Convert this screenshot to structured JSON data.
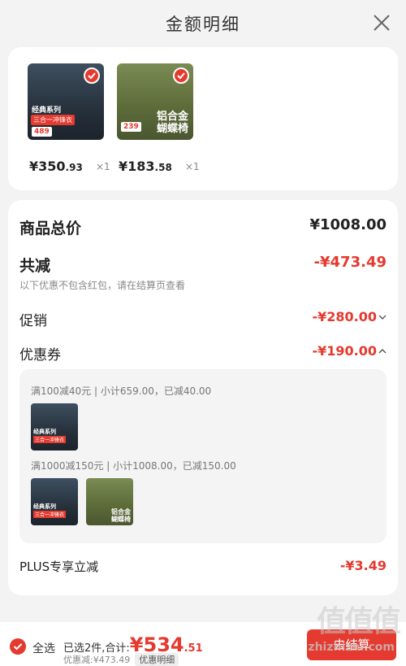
{
  "header": {
    "title": "金额明细"
  },
  "products": [
    {
      "thumb_title": "经典系列",
      "thumb_sub": "三合一冲锋衣",
      "thumb_price": "489",
      "price_int": "¥350",
      "price_dec": ".93",
      "qty": "×1",
      "icon": "jacket-image"
    },
    {
      "thumb_title": "铝合金",
      "thumb_sub": "蝴蝶椅",
      "thumb_price": "239",
      "price_int": "¥183",
      "price_dec": ".58",
      "qty": "×1",
      "icon": "chair-image"
    }
  ],
  "summary": {
    "goods_total_label": "商品总价",
    "goods_total": "¥1008.00",
    "total_discount_label": "共减",
    "total_discount": "-¥473.49",
    "note": "以下优惠不包含红包，请在结算页查看",
    "promo_label": "促销",
    "promo_value": "-¥280.00",
    "coupon_label": "优惠券",
    "coupon_value": "-¥190.00",
    "plus_label": "PLUS专享立减",
    "plus_value": "-¥3.49"
  },
  "coupons": [
    {
      "rule": "满100减40元 | 小计659.00，已减40.00"
    },
    {
      "rule": "满1000减150元 | 小计1008.00，已减150.00"
    }
  ],
  "bottom_bar": {
    "select_all": "全选",
    "selected_text": "已选2件,合计:",
    "total_int": "¥534",
    "total_dec": ".51",
    "discount_text": "优惠减:¥473.49",
    "detail_btn": "优惠明细",
    "checkout": "去结算"
  },
  "watermark": {
    "main": "值值值",
    "sub": "zhizhizhi.com"
  },
  "colors": {
    "accent": "#e43a2f"
  }
}
